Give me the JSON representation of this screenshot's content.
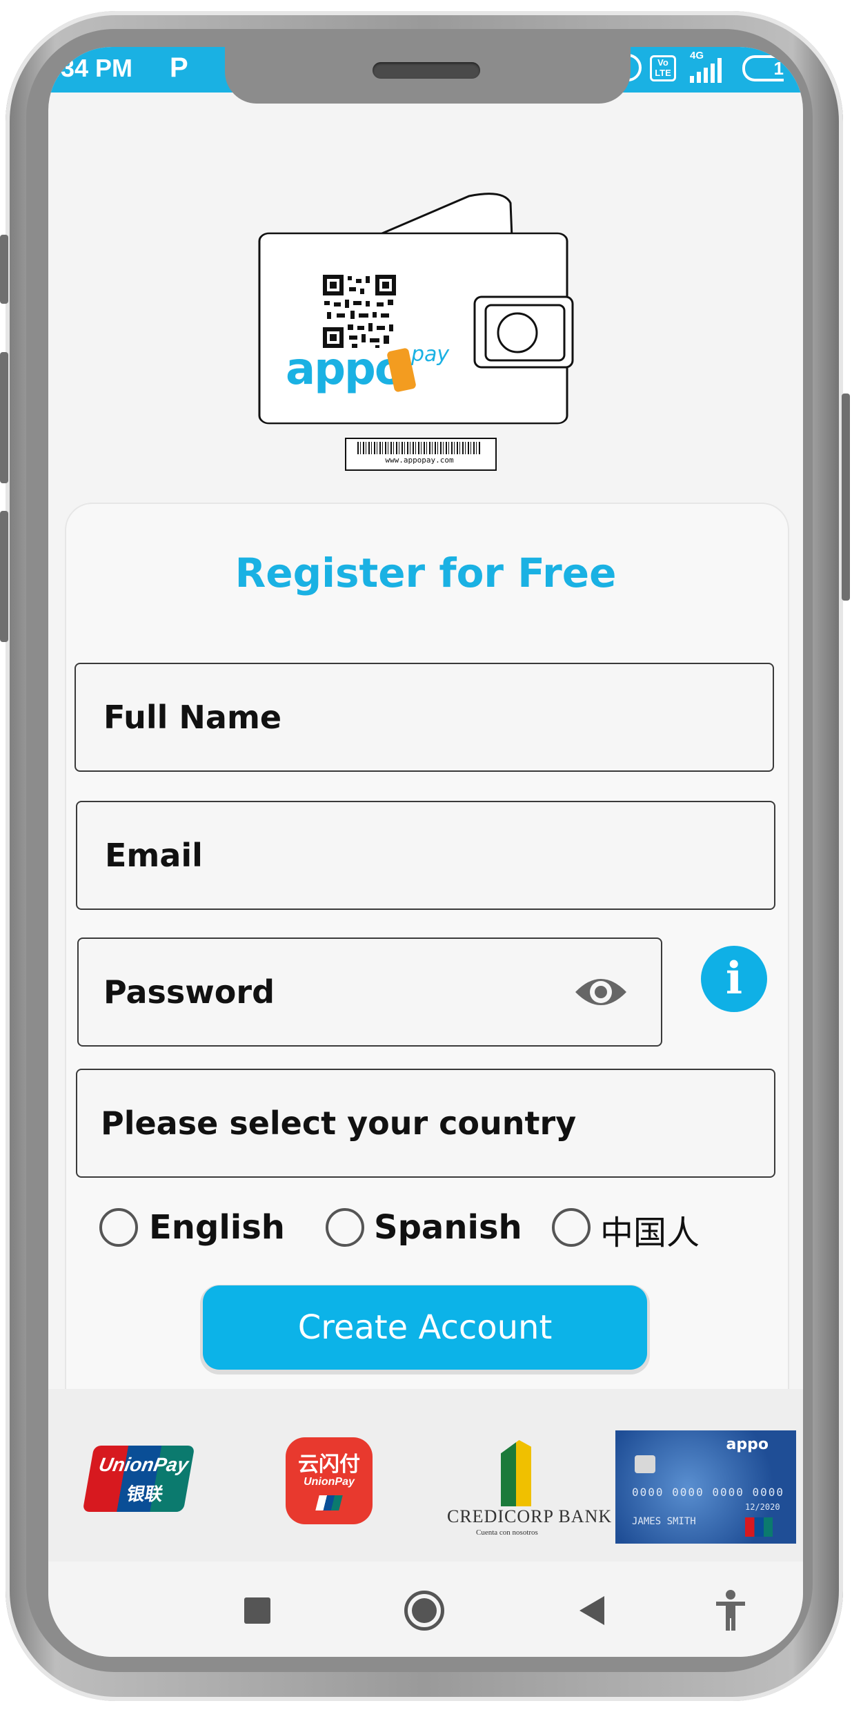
{
  "status_bar": {
    "time": ":34 PM",
    "app_letter": "P",
    "volte": "Vo LTE",
    "network": "4G",
    "battery": "1"
  },
  "illustration": {
    "brand_main": "appo",
    "brand_sub": "pay",
    "barcode_url": "www.appopay.com"
  },
  "form": {
    "title": "Register for Free",
    "full_name_label": "Full Name",
    "email_label": "Email",
    "password_label": "Password",
    "country_label": "Please select your country",
    "info_symbol": "i",
    "languages": [
      "English",
      "Spanish",
      "中国人"
    ],
    "create_account_label": "Create Account"
  },
  "partners": {
    "unionpay_text": "UnionPay",
    "unionpay_cn": "银联",
    "yunshanfu_cn": "云闪付",
    "yunshanfu_sub": "UnionPay",
    "credicorp_name": "CREDICORP BANK",
    "credicorp_tagline": "Cuenta con nosotros",
    "card_brand": "appo",
    "card_number": "0000 0000 0000 0000",
    "card_expiry": "12/2020",
    "card_holder": "JAMES SMITH"
  },
  "colors": {
    "accent": "#1ab1e3",
    "button": "#0cb3e8",
    "text": "#111111",
    "brand_orange": "#f39c20"
  }
}
